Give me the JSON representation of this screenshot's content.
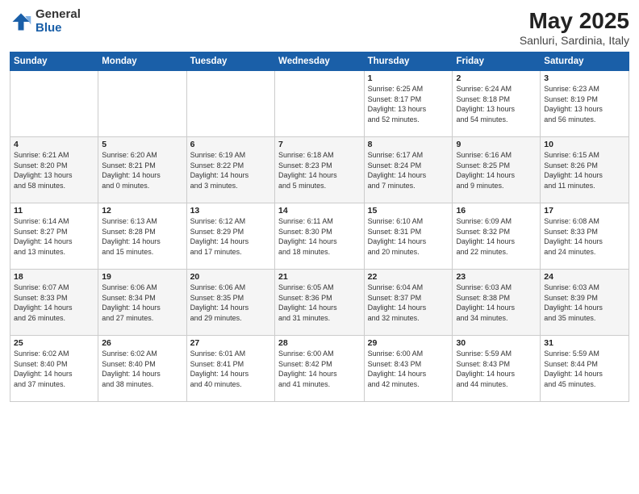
{
  "header": {
    "logo_general": "General",
    "logo_blue": "Blue",
    "title": "May 2025",
    "location": "Sanluri, Sardinia, Italy"
  },
  "days_of_week": [
    "Sunday",
    "Monday",
    "Tuesday",
    "Wednesday",
    "Thursday",
    "Friday",
    "Saturday"
  ],
  "weeks": [
    [
      {
        "day": "",
        "info": ""
      },
      {
        "day": "",
        "info": ""
      },
      {
        "day": "",
        "info": ""
      },
      {
        "day": "",
        "info": ""
      },
      {
        "day": "1",
        "info": "Sunrise: 6:25 AM\nSunset: 8:17 PM\nDaylight: 13 hours\nand 52 minutes."
      },
      {
        "day": "2",
        "info": "Sunrise: 6:24 AM\nSunset: 8:18 PM\nDaylight: 13 hours\nand 54 minutes."
      },
      {
        "day": "3",
        "info": "Sunrise: 6:23 AM\nSunset: 8:19 PM\nDaylight: 13 hours\nand 56 minutes."
      }
    ],
    [
      {
        "day": "4",
        "info": "Sunrise: 6:21 AM\nSunset: 8:20 PM\nDaylight: 13 hours\nand 58 minutes."
      },
      {
        "day": "5",
        "info": "Sunrise: 6:20 AM\nSunset: 8:21 PM\nDaylight: 14 hours\nand 0 minutes."
      },
      {
        "day": "6",
        "info": "Sunrise: 6:19 AM\nSunset: 8:22 PM\nDaylight: 14 hours\nand 3 minutes."
      },
      {
        "day": "7",
        "info": "Sunrise: 6:18 AM\nSunset: 8:23 PM\nDaylight: 14 hours\nand 5 minutes."
      },
      {
        "day": "8",
        "info": "Sunrise: 6:17 AM\nSunset: 8:24 PM\nDaylight: 14 hours\nand 7 minutes."
      },
      {
        "day": "9",
        "info": "Sunrise: 6:16 AM\nSunset: 8:25 PM\nDaylight: 14 hours\nand 9 minutes."
      },
      {
        "day": "10",
        "info": "Sunrise: 6:15 AM\nSunset: 8:26 PM\nDaylight: 14 hours\nand 11 minutes."
      }
    ],
    [
      {
        "day": "11",
        "info": "Sunrise: 6:14 AM\nSunset: 8:27 PM\nDaylight: 14 hours\nand 13 minutes."
      },
      {
        "day": "12",
        "info": "Sunrise: 6:13 AM\nSunset: 8:28 PM\nDaylight: 14 hours\nand 15 minutes."
      },
      {
        "day": "13",
        "info": "Sunrise: 6:12 AM\nSunset: 8:29 PM\nDaylight: 14 hours\nand 17 minutes."
      },
      {
        "day": "14",
        "info": "Sunrise: 6:11 AM\nSunset: 8:30 PM\nDaylight: 14 hours\nand 18 minutes."
      },
      {
        "day": "15",
        "info": "Sunrise: 6:10 AM\nSunset: 8:31 PM\nDaylight: 14 hours\nand 20 minutes."
      },
      {
        "day": "16",
        "info": "Sunrise: 6:09 AM\nSunset: 8:32 PM\nDaylight: 14 hours\nand 22 minutes."
      },
      {
        "day": "17",
        "info": "Sunrise: 6:08 AM\nSunset: 8:33 PM\nDaylight: 14 hours\nand 24 minutes."
      }
    ],
    [
      {
        "day": "18",
        "info": "Sunrise: 6:07 AM\nSunset: 8:33 PM\nDaylight: 14 hours\nand 26 minutes."
      },
      {
        "day": "19",
        "info": "Sunrise: 6:06 AM\nSunset: 8:34 PM\nDaylight: 14 hours\nand 27 minutes."
      },
      {
        "day": "20",
        "info": "Sunrise: 6:06 AM\nSunset: 8:35 PM\nDaylight: 14 hours\nand 29 minutes."
      },
      {
        "day": "21",
        "info": "Sunrise: 6:05 AM\nSunset: 8:36 PM\nDaylight: 14 hours\nand 31 minutes."
      },
      {
        "day": "22",
        "info": "Sunrise: 6:04 AM\nSunset: 8:37 PM\nDaylight: 14 hours\nand 32 minutes."
      },
      {
        "day": "23",
        "info": "Sunrise: 6:03 AM\nSunset: 8:38 PM\nDaylight: 14 hours\nand 34 minutes."
      },
      {
        "day": "24",
        "info": "Sunrise: 6:03 AM\nSunset: 8:39 PM\nDaylight: 14 hours\nand 35 minutes."
      }
    ],
    [
      {
        "day": "25",
        "info": "Sunrise: 6:02 AM\nSunset: 8:40 PM\nDaylight: 14 hours\nand 37 minutes."
      },
      {
        "day": "26",
        "info": "Sunrise: 6:02 AM\nSunset: 8:40 PM\nDaylight: 14 hours\nand 38 minutes."
      },
      {
        "day": "27",
        "info": "Sunrise: 6:01 AM\nSunset: 8:41 PM\nDaylight: 14 hours\nand 40 minutes."
      },
      {
        "day": "28",
        "info": "Sunrise: 6:00 AM\nSunset: 8:42 PM\nDaylight: 14 hours\nand 41 minutes."
      },
      {
        "day": "29",
        "info": "Sunrise: 6:00 AM\nSunset: 8:43 PM\nDaylight: 14 hours\nand 42 minutes."
      },
      {
        "day": "30",
        "info": "Sunrise: 5:59 AM\nSunset: 8:43 PM\nDaylight: 14 hours\nand 44 minutes."
      },
      {
        "day": "31",
        "info": "Sunrise: 5:59 AM\nSunset: 8:44 PM\nDaylight: 14 hours\nand 45 minutes."
      }
    ]
  ]
}
